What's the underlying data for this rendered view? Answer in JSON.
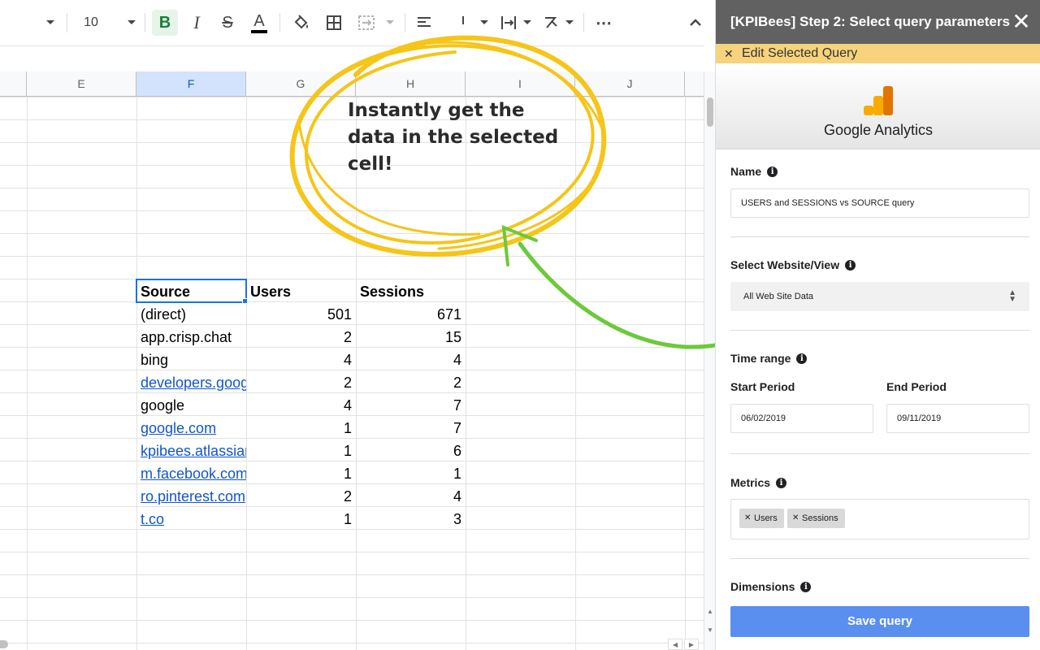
{
  "toolbar": {
    "font_size": "10",
    "bold_label": "B",
    "italic_label": "I",
    "strike_label": "S",
    "text_color_label": "A",
    "more_label": "⋯"
  },
  "grid": {
    "columns": [
      "E",
      "F",
      "G",
      "H",
      "I",
      "J"
    ],
    "header": {
      "source": "Source",
      "users": "Users",
      "sessions": "Sessions"
    },
    "rows": [
      {
        "source": "(direct)",
        "users": "501",
        "sessions": "671",
        "link": false
      },
      {
        "source": "app.crisp.chat",
        "users": "2",
        "sessions": "15",
        "link": false
      },
      {
        "source": "bing",
        "users": "4",
        "sessions": "4",
        "link": false
      },
      {
        "source": "developers.goog",
        "users": "2",
        "sessions": "2",
        "link": true
      },
      {
        "source": "google",
        "users": "4",
        "sessions": "7",
        "link": false
      },
      {
        "source": "google.com",
        "users": "1",
        "sessions": "7",
        "link": true
      },
      {
        "source": "kpibees.atlassiar",
        "users": "1",
        "sessions": "6",
        "link": true
      },
      {
        "source": "m.facebook.com",
        "users": "1",
        "sessions": "1",
        "link": true
      },
      {
        "source": "ro.pinterest.com",
        "users": "2",
        "sessions": "4",
        "link": true
      },
      {
        "source": "t.co",
        "users": "1",
        "sessions": "3",
        "link": true
      }
    ]
  },
  "annotation": {
    "text": "Instantly get the data in the selected cell!",
    "circle_color": "#f5c518",
    "arrow_color": "#6cc93b"
  },
  "panel": {
    "title": "[KPIBees] Step 2: Select query parameters",
    "edit_bar": "Edit Selected Query",
    "service_name": "Google Analytics",
    "name_label": "Name",
    "name_value": "USERS and SESSIONS vs SOURCE query",
    "website_label": "Select Website/View",
    "website_value": "All Web Site Data",
    "time_range_label": "Time range",
    "start_label": "Start Period",
    "start_value": "06/02/2019",
    "end_label": "End Period",
    "end_value": "09/11/2019",
    "metrics_label": "Metrics",
    "metrics": [
      "Users",
      "Sessions"
    ],
    "dimensions_label": "Dimensions",
    "save_label": "Save query",
    "colors": {
      "header_bg": "#616161",
      "edit_bar_bg": "#f6d37c",
      "save_bg": "#5a8ff0",
      "ga_orange": "#f9ab00"
    }
  }
}
